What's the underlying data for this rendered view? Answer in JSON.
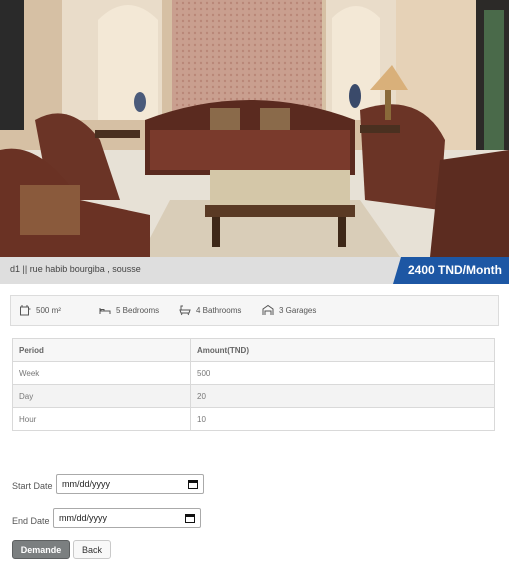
{
  "listing": {
    "address": "d1 || rue habib bourgiba , sousse",
    "price": "2400 TND/Month"
  },
  "features": {
    "area": "500 m²",
    "bedrooms": "5 Bedrooms",
    "bathrooms": "4 Bathrooms",
    "garages": "3 Garages"
  },
  "pricing_table": {
    "headers": [
      "Period",
      "Amount(TND)"
    ],
    "rows": [
      [
        "Week",
        "500"
      ],
      [
        "Day",
        "20"
      ],
      [
        "Hour",
        "10"
      ]
    ]
  },
  "form": {
    "start_label": "Start Date",
    "end_label": "End Date",
    "date_placeholder": "mm/dd/yyyy",
    "submit_label": "Demande",
    "back_label": "Back"
  },
  "icons": {
    "area": "area-icon",
    "bed": "bed-icon",
    "bath": "bathtub-icon",
    "garage": "garage-icon",
    "calendar": "calendar-icon"
  },
  "colors": {
    "price_badge": "#1d57a4",
    "address_bar": "#dedede",
    "submit_button": "#7b7f80"
  }
}
